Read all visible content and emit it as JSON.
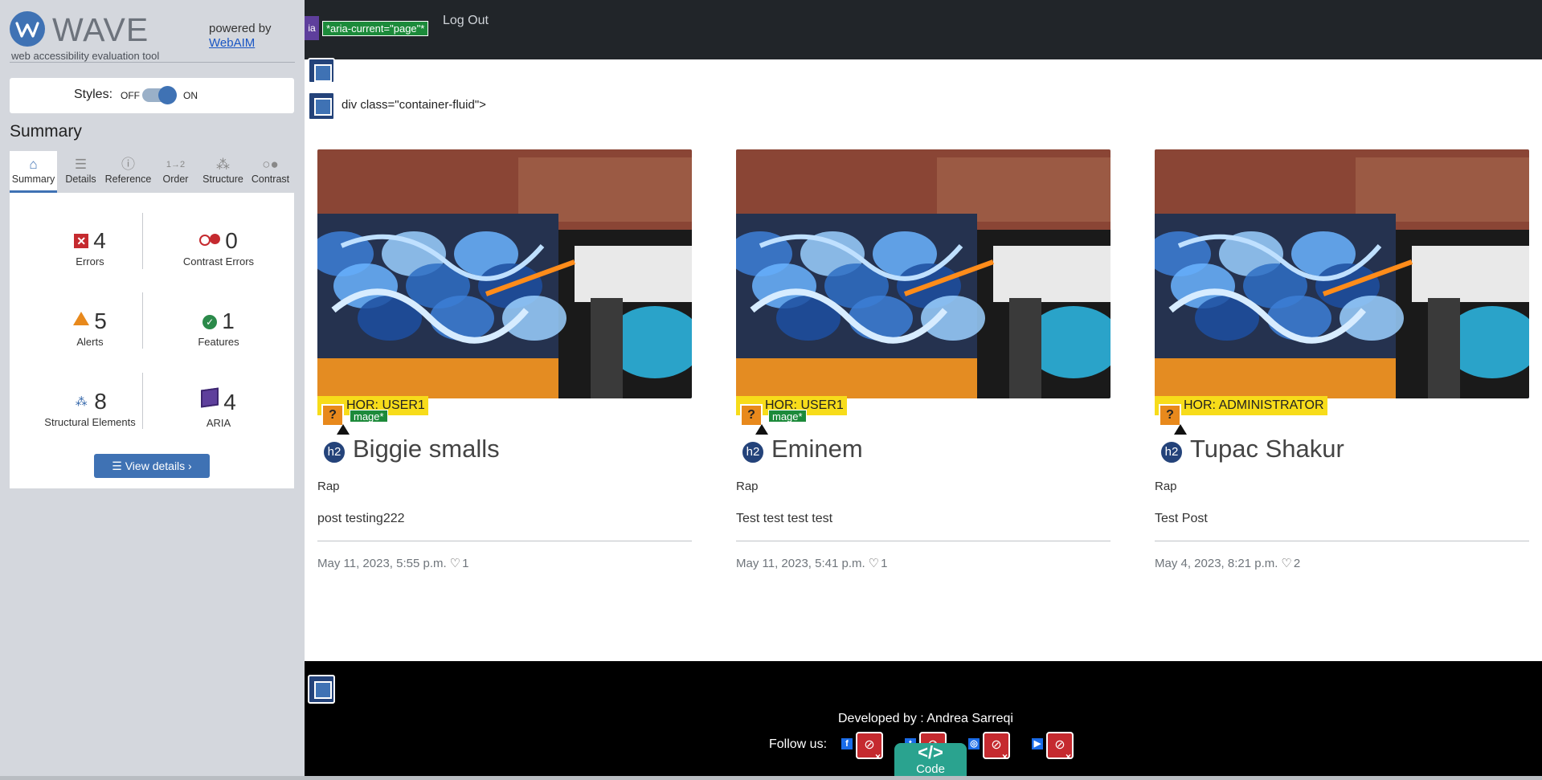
{
  "wave": {
    "logo_word": "WAVE",
    "tagline": "web accessibility evaluation tool",
    "powered_by": "powered by",
    "webaim_link": "WebAIM",
    "styles_label": "Styles:",
    "styles_off": "OFF",
    "styles_on": "ON",
    "styles_enabled": true,
    "summary_heading": "Summary",
    "tabs": [
      {
        "label": "Summary",
        "icon": "home-icon",
        "active": true
      },
      {
        "label": "Details",
        "icon": "list-icon",
        "active": false
      },
      {
        "label": "Reference",
        "icon": "info-icon",
        "active": false
      },
      {
        "label": "Order",
        "icon": "order-icon",
        "active": false
      },
      {
        "label": "Structure",
        "icon": "structure-icon",
        "active": false
      },
      {
        "label": "Contrast",
        "icon": "contrast-icon",
        "active": false
      }
    ],
    "stats": {
      "errors": {
        "value": "4",
        "label": "Errors",
        "color": "#c52a2f"
      },
      "contrast": {
        "value": "0",
        "label": "Contrast Errors",
        "color": "#c52a2f"
      },
      "alerts": {
        "value": "5",
        "label": "Alerts",
        "color": "#e8891c"
      },
      "features": {
        "value": "1",
        "label": "Features",
        "color": "#2b8a4a"
      },
      "structural": {
        "value": "8",
        "label": "Structural Elements",
        "color": "#2f63a8"
      },
      "aria": {
        "value": "4",
        "label": "ARIA",
        "color": "#5e3f9c"
      }
    },
    "view_details": "View details ›",
    "accent_color": "#3f72b4"
  },
  "page": {
    "nav": {
      "aria_icon": "ia",
      "aria_current_tag": "*aria-current=\"page\"*",
      "logout": "Log Out"
    },
    "container_label": "div class=\"container-fluid\">",
    "posts": [
      {
        "author": "HOR: USER1",
        "image_tag": "mage*",
        "title": "Biggie smalls",
        "genre": "Rap",
        "body": "post testing222",
        "date": "May 11, 2023, 5:55 p.m.",
        "likes": "1"
      },
      {
        "author": "HOR: USER1",
        "image_tag": "mage*",
        "title": "Eminem",
        "genre": "Rap",
        "body": "Test test test test",
        "date": "May 11, 2023, 5:41 p.m.",
        "likes": "1"
      },
      {
        "author": "HOR: ADMINISTRATOR",
        "image_tag": "",
        "title": "Tupac Shakur",
        "genre": "Rap",
        "body": "Test Post",
        "date": "May 4, 2023, 8:21 p.m.",
        "likes": "2"
      }
    ],
    "footer": {
      "developed_by": "Developed by : Andrea Sarreqi",
      "follow_us": "Follow us:",
      "social": [
        {
          "icon": "facebook-icon",
          "glyph": "f"
        },
        {
          "icon": "twitter-icon",
          "glyph": "t"
        },
        {
          "icon": "instagram-icon",
          "glyph": "◎"
        },
        {
          "icon": "youtube-icon",
          "glyph": "▶"
        }
      ],
      "code_button_glyph": "</>",
      "code_button": "Code"
    }
  }
}
